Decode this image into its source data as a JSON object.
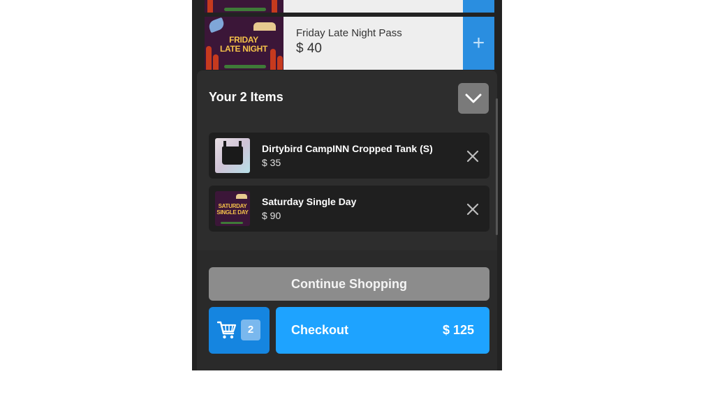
{
  "products": [
    {
      "image_text": "",
      "name": "",
      "price": ""
    },
    {
      "image_text": "FRIDAY LATE NIGHT",
      "name": "Friday Late Night Pass",
      "price": "$ 40"
    }
  ],
  "cart": {
    "title": "Your 2 Items",
    "items": [
      {
        "name": "Dirtybird CampINN Cropped Tank (S)",
        "price": "$ 35"
      },
      {
        "name": "Saturday Single Day",
        "price": "$ 90",
        "image_text": "SATURDAY SINGLE DAY"
      }
    ],
    "continue_label": "Continue Shopping",
    "count": "2",
    "checkout_label": "Checkout",
    "total": "$ 125"
  },
  "colors": {
    "accent": "#1ea3ff",
    "cart_button": "#1585e0",
    "continue_button": "#8c8c8c",
    "sheet_background": "#2d2d2d"
  },
  "icons": [
    "plus-icon",
    "chevron-down-icon",
    "close-icon",
    "cart-icon"
  ]
}
